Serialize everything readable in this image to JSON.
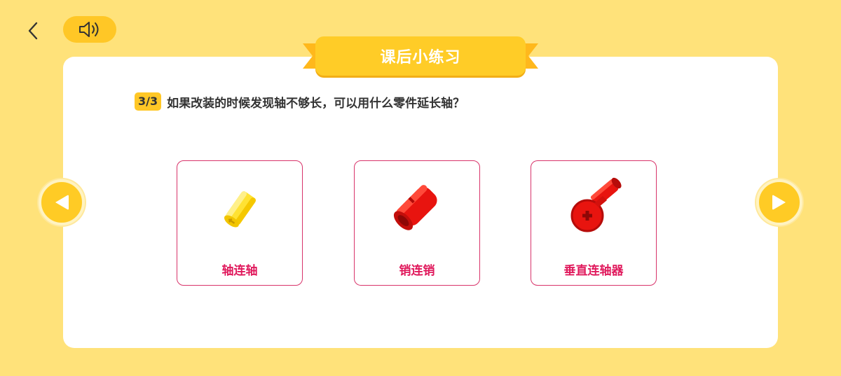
{
  "header": {
    "back_icon": "chevron-left-icon",
    "sound_icon": "speaker-icon"
  },
  "banner": {
    "title": "课后小练习"
  },
  "question": {
    "progress": "3/3",
    "text": "如果改装的时候发现轴不够长，可以用什么零件延长轴？"
  },
  "options": [
    {
      "label": "轴连轴",
      "image": "yellow-axle-connector",
      "color": "#FFE233"
    },
    {
      "label": "销连销",
      "image": "red-pin-connector",
      "color": "#E8140F"
    },
    {
      "label": "垂直连轴器",
      "image": "red-perpendicular-connector",
      "color": "#E8140F"
    }
  ],
  "nav": {
    "prev_icon": "play-left-icon",
    "next_icon": "play-right-icon"
  },
  "colors": {
    "background": "#FFE27A",
    "accent": "#FFC726",
    "option_border": "#D8336A",
    "option_label": "#E0195C"
  }
}
